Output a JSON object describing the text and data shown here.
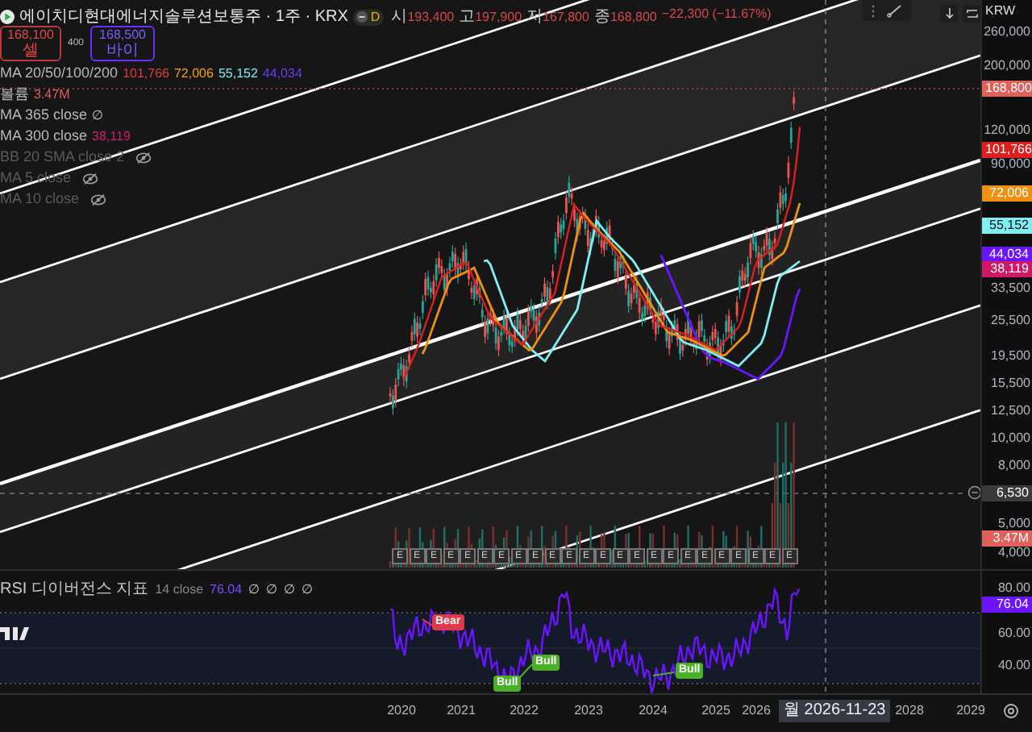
{
  "header": {
    "title": "에이치디현대에너지솔루션보통주 · 1주 · KRX",
    "interval_badge": "D",
    "ohlc": [
      {
        "label": "시",
        "value": "193,400"
      },
      {
        "label": "고",
        "value": "197,900"
      },
      {
        "label": "저",
        "value": "167,800"
      },
      {
        "label": "종",
        "value": "168,800"
      }
    ],
    "change": "−22,300 (−11.67%)"
  },
  "trade": {
    "sell_price": "168,100",
    "sell_label": "셀",
    "spread": "400",
    "buy_price": "168,500",
    "buy_label": "바이"
  },
  "legend": [
    {
      "title": "MA 20/50/100/200",
      "hidden": false,
      "values": [
        {
          "text": "101,766",
          "color": "#e23a3a"
        },
        {
          "text": "72,006",
          "color": "#f0a010"
        },
        {
          "text": "55,152",
          "color": "#7ee8f0"
        },
        {
          "text": "44,034",
          "color": "#6a3cff"
        }
      ]
    },
    {
      "title": "볼륨",
      "hidden": false,
      "values": [
        {
          "text": "3.47M",
          "color": "#e0605a"
        }
      ]
    },
    {
      "title": "MA 365 close",
      "hidden": false,
      "values": [
        {
          "text": "∅",
          "color": "#c8c8c8"
        }
      ]
    },
    {
      "title": "MA 300 close",
      "hidden": false,
      "values": [
        {
          "text": "38,119",
          "color": "#d0206a"
        }
      ]
    },
    {
      "title": "BB 20 SMA close 2",
      "hidden": true
    },
    {
      "title": "MA 5 close",
      "hidden": true
    },
    {
      "title": "MA 10 close",
      "hidden": true
    }
  ],
  "price_axis": {
    "currency": "KRW",
    "labels": [
      {
        "text": "260,000",
        "kind": "tick"
      },
      {
        "text": "200,000",
        "kind": "tick"
      },
      {
        "text": "168,800",
        "kind": "badge",
        "color": "#e0605a"
      },
      {
        "text": "120,000",
        "kind": "tick"
      },
      {
        "text": "101,766",
        "kind": "badge",
        "color": "#e01e1e"
      },
      {
        "text": "90,000",
        "kind": "tick"
      },
      {
        "text": "72,006",
        "kind": "badge",
        "color": "#f09010"
      },
      {
        "text": "55,152",
        "kind": "badge",
        "color": "#7ef0f4"
      },
      {
        "text": "44,034",
        "kind": "badge",
        "color": "#6a14ff"
      },
      {
        "text": "38,119",
        "kind": "badge",
        "color": "#d01868"
      },
      {
        "text": "33,500",
        "kind": "tick"
      },
      {
        "text": "25,500",
        "kind": "tick"
      },
      {
        "text": "19,500",
        "kind": "tick"
      },
      {
        "text": "15,500",
        "kind": "tick"
      },
      {
        "text": "12,500",
        "kind": "tick"
      },
      {
        "text": "10,000",
        "kind": "tick"
      },
      {
        "text": "8,000",
        "kind": "tick"
      },
      {
        "text": "6,530",
        "kind": "badge",
        "color": "#3a3a3a"
      },
      {
        "text": "5,000",
        "kind": "tick"
      },
      {
        "text": "3.47M",
        "kind": "badge",
        "color": "#e0605a"
      },
      {
        "text": "4,000",
        "kind": "tick"
      }
    ]
  },
  "earnings_markers": [
    "E",
    "E",
    "E",
    "E",
    "E",
    "E",
    "E",
    "E",
    "E",
    "E",
    "E",
    "E",
    "E",
    "E",
    "E",
    "E",
    "E",
    "E",
    "E",
    "E",
    "E",
    "E",
    "E",
    "E"
  ],
  "rsi": {
    "title": "RSI 디이버전스 지표",
    "params": "14 close",
    "value": "76.04",
    "empties": [
      "∅",
      "∅",
      "∅",
      "∅"
    ],
    "signals": [
      {
        "kind": "bear",
        "text": "Bear"
      },
      {
        "kind": "bull",
        "text": "Bull"
      },
      {
        "kind": "bull",
        "text": "Bull"
      },
      {
        "kind": "bull",
        "text": "Bull"
      }
    ],
    "axis": [
      {
        "text": "80.00",
        "kind": "tick"
      },
      {
        "text": "76.04",
        "kind": "badge",
        "color": "#6a14ff"
      },
      {
        "text": "60.00",
        "kind": "tick"
      },
      {
        "text": "40.00",
        "kind": "tick"
      }
    ]
  },
  "time_axis": [
    {
      "text": "2020",
      "kind": "year"
    },
    {
      "text": "2021",
      "kind": "year"
    },
    {
      "text": "2022",
      "kind": "year"
    },
    {
      "text": "2023",
      "kind": "year"
    },
    {
      "text": "2024",
      "kind": "year"
    },
    {
      "text": "2025",
      "kind": "year"
    },
    {
      "text": "2026",
      "kind": "year"
    },
    {
      "text": "월 2026-11-23",
      "kind": "cursor"
    },
    {
      "text": "2028",
      "kind": "year"
    },
    {
      "text": "2029",
      "kind": "year"
    }
  ]
}
